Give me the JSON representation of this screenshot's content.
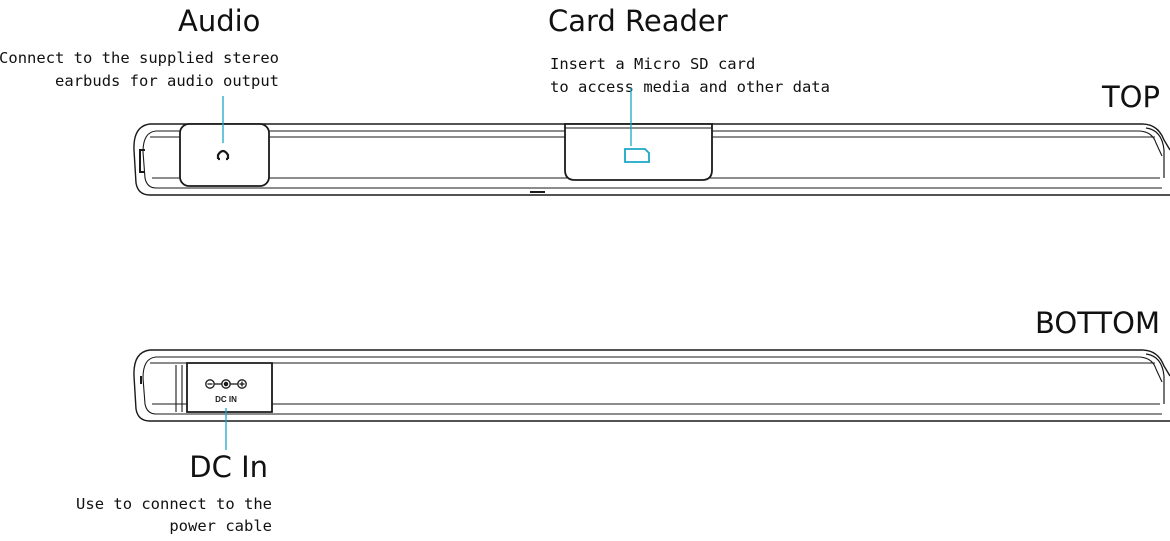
{
  "labels": {
    "top": "TOP",
    "bottom": "BOTTOM"
  },
  "callouts": {
    "audio": {
      "title": "Audio",
      "lines": [
        "Connect to the supplied stereo",
        "earbuds for audio output"
      ]
    },
    "card_reader": {
      "title": "Card Reader",
      "lines": [
        "Insert a Micro SD card",
        "to access media and other data"
      ]
    },
    "dc_in": {
      "title": "DC In",
      "lines": [
        "Use to connect to the",
        "power cable"
      ]
    }
  },
  "port_markings": {
    "dc_label": "DC IN"
  },
  "icons": {
    "audio_port": "headphone-jack-icon",
    "card_slot": "micro-sd-slot-icon",
    "dc_polarity": "polarity-symbol-icon"
  },
  "colors": {
    "leader_line": "#1aa7c7",
    "device_stroke": "#1a1a1a",
    "text": "#111111"
  }
}
